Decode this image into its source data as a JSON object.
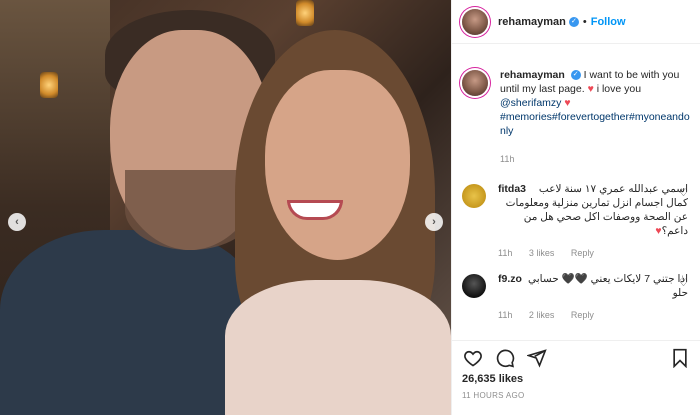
{
  "post": {
    "username": "rehamayman",
    "follow_label": "Follow",
    "dot": "•",
    "caption": {
      "username": "rehamayman",
      "text_1": "I want to be with you until my last page.",
      "text_2": "i love you",
      "mention": "@sherifamzy",
      "hashtags": "#memories#forevertogether#myoneandonly",
      "time": "11h"
    },
    "comments": [
      {
        "username": "fitda3",
        "text": "اسمي عبدالله عمري ١٧ سنة لاعب كمال اجسام انزل تمارين منزلية ومعلومات عن الصحة ووصفات اكل صحي هل من داعم؟",
        "time": "11h",
        "likes": "3 likes",
        "reply": "Reply",
        "avatar_color": "#c9a227"
      },
      {
        "username": "f9.zo",
        "text": "اذا جتني 7 لايكات يعني 🖤🖤 حسابي حلو",
        "time": "11h",
        "likes": "2 likes",
        "reply": "Reply",
        "avatar_color": "#1a1a1a"
      }
    ],
    "likes_count": "26,635 likes",
    "posted_ago": "11 HOURS AGO"
  },
  "icons": {
    "heart": "heart-icon",
    "comment": "comment-icon",
    "share": "share-icon",
    "bookmark": "bookmark-icon",
    "prev": "chevron-left-icon",
    "next": "chevron-right-icon"
  },
  "colors": {
    "link": "#0095f6",
    "tag": "#00376b",
    "heart": "#ed4956",
    "muted": "#8e8e8e",
    "verified": "#3897f0"
  }
}
